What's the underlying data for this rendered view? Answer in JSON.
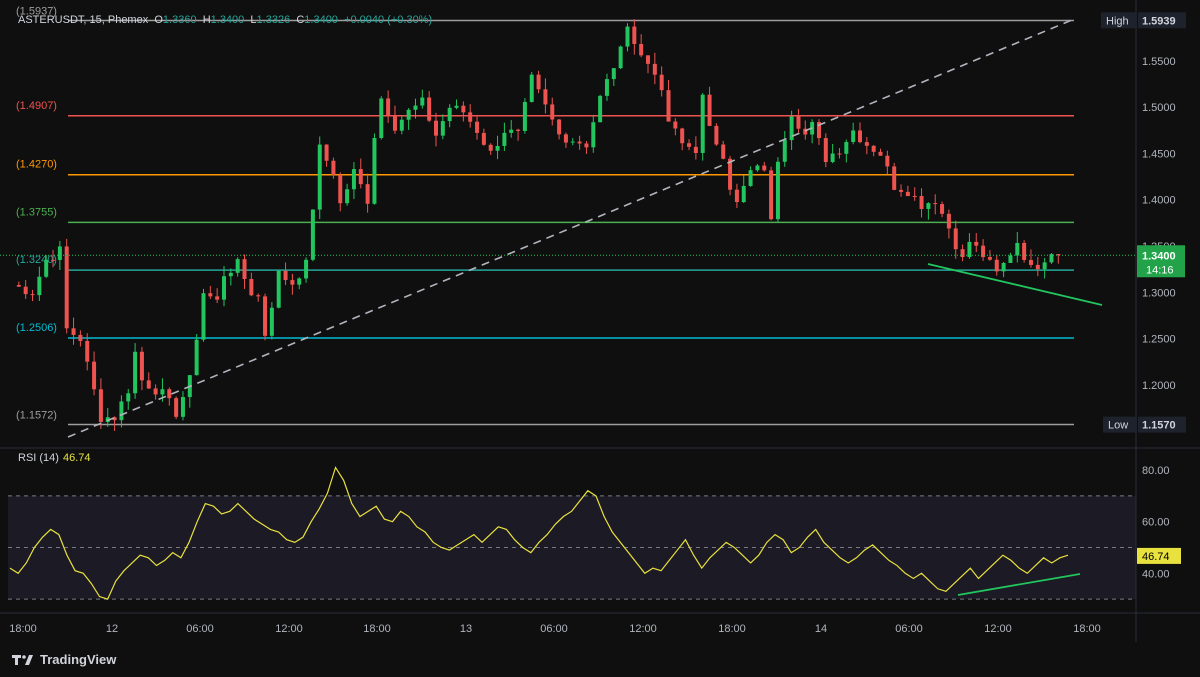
{
  "header": {
    "symbol": "ASTERUSDT, 15, Phemex",
    "open_label": "O",
    "open": "1.3360",
    "high_label": "H",
    "high": "1.3400",
    "low_label": "L",
    "low": "1.3326",
    "close_label": "C",
    "close": "1.3400",
    "change": "+0.0040 (+0.30%)"
  },
  "brand": "TradingView",
  "rsi_header": {
    "label": "RSI (14)",
    "value": "46.74"
  },
  "colors": {
    "up": "#26a69a",
    "up_bright": "#22c55e",
    "down": "#ef5350",
    "rsi": "#e8e13e"
  },
  "chart_data": [
    {
      "type": "candlestick",
      "ylim": [
        1.135,
        1.605
      ],
      "y_ticks": [
        "1.5500",
        "1.5000",
        "1.4500",
        "1.4000",
        "1.3500",
        "1.3000",
        "1.2500",
        "1.2000"
      ],
      "x_ticks": [
        "18:00",
        "12",
        "06:00",
        "12:00",
        "18:00",
        "13",
        "06:00",
        "12:00",
        "18:00",
        "14",
        "06:00",
        "12:00",
        "18:00"
      ],
      "levels": [
        {
          "label": "(1.5937)",
          "value": 1.5937,
          "color": "#9e9e9e"
        },
        {
          "label": "(1.4907)",
          "value": 1.4907,
          "color": "#ef5350"
        },
        {
          "label": "(1.4270)",
          "value": 1.427,
          "color": "#ff9800"
        },
        {
          "label": "(1.3755)",
          "value": 1.3755,
          "color": "#4caf50"
        },
        {
          "label": "(1.3240)",
          "value": 1.324,
          "color": "#26a69a"
        },
        {
          "label": "(1.2506)",
          "value": 1.2506,
          "color": "#00bcd4"
        },
        {
          "label": "(1.1572)",
          "value": 1.1572,
          "color": "#9e9e9e"
        }
      ],
      "high_badge": {
        "label": "High",
        "value": "1.5939"
      },
      "low_badge": {
        "label": "Low",
        "value": "1.1570"
      },
      "last_price": {
        "value": "1.3400",
        "countdown": "14:16"
      },
      "path": [
        [
          0,
          1.308
        ],
        [
          3,
          1.3
        ],
        [
          5,
          1.335
        ],
        [
          7,
          1.345
        ],
        [
          8,
          1.26
        ],
        [
          10,
          1.25
        ],
        [
          13,
          1.165
        ],
        [
          15,
          1.165
        ],
        [
          17,
          1.195
        ],
        [
          18,
          1.235
        ],
        [
          19,
          1.205
        ],
        [
          22,
          1.19
        ],
        [
          24,
          1.17
        ],
        [
          26,
          1.205
        ],
        [
          28,
          1.3
        ],
        [
          30,
          1.29
        ],
        [
          31,
          1.32
        ],
        [
          33,
          1.33
        ],
        [
          35,
          1.3
        ],
        [
          36,
          1.295
        ],
        [
          37,
          1.255
        ],
        [
          39,
          1.32
        ],
        [
          41,
          1.31
        ],
        [
          43,
          1.33
        ],
        [
          45,
          1.455
        ],
        [
          47,
          1.43
        ],
        [
          48,
          1.395
        ],
        [
          50,
          1.43
        ],
        [
          52,
          1.4
        ],
        [
          53,
          1.47
        ],
        [
          54,
          1.51
        ],
        [
          56,
          1.48
        ],
        [
          58,
          1.495
        ],
        [
          60,
          1.505
        ],
        [
          62,
          1.47
        ],
        [
          64,
          1.5
        ],
        [
          66,
          1.495
        ],
        [
          68,
          1.475
        ],
        [
          70,
          1.45
        ],
        [
          72,
          1.475
        ],
        [
          74,
          1.47
        ],
        [
          76,
          1.53
        ],
        [
          78,
          1.5
        ],
        [
          80,
          1.47
        ],
        [
          82,
          1.465
        ],
        [
          84,
          1.46
        ],
        [
          86,
          1.51
        ],
        [
          88,
          1.545
        ],
        [
          89,
          1.56
        ],
        [
          90,
          1.593
        ],
        [
          91,
          1.57
        ],
        [
          92,
          1.555
        ],
        [
          94,
          1.54
        ],
        [
          96,
          1.485
        ],
        [
          98,
          1.46
        ],
        [
          100,
          1.455
        ],
        [
          101,
          1.51
        ],
        [
          102,
          1.475
        ],
        [
          104,
          1.45
        ],
        [
          105,
          1.415
        ],
        [
          106,
          1.395
        ],
        [
          108,
          1.43
        ],
        [
          110,
          1.435
        ],
        [
          111,
          1.375
        ],
        [
          112,
          1.445
        ],
        [
          114,
          1.495
        ],
        [
          116,
          1.47
        ],
        [
          117,
          1.48
        ],
        [
          119,
          1.445
        ],
        [
          121,
          1.455
        ],
        [
          123,
          1.475
        ],
        [
          125,
          1.46
        ],
        [
          127,
          1.45
        ],
        [
          129,
          1.415
        ],
        [
          131,
          1.41
        ],
        [
          133,
          1.395
        ],
        [
          135,
          1.4
        ],
        [
          137,
          1.37
        ],
        [
          139,
          1.335
        ],
        [
          140,
          1.355
        ],
        [
          142,
          1.34
        ],
        [
          144,
          1.32
        ],
        [
          145,
          1.33
        ],
        [
          147,
          1.355
        ],
        [
          149,
          1.325
        ],
        [
          150,
          1.33
        ],
        [
          152,
          1.345
        ],
        [
          153,
          1.34
        ]
      ]
    },
    {
      "type": "line",
      "title": "RSI (14)",
      "ylim": [
        25,
        87
      ],
      "y_ticks": [
        "80.00",
        "60.00",
        "40.00"
      ],
      "bands": [
        70,
        50,
        30
      ],
      "last_value": "46.74",
      "values": [
        42,
        40,
        44,
        50,
        54,
        57,
        55,
        47,
        41,
        40,
        36,
        31,
        30,
        37,
        41,
        44,
        47,
        46,
        43,
        45,
        48,
        46,
        52,
        60,
        67,
        66,
        63,
        64,
        67,
        64,
        61,
        59,
        57,
        56,
        53,
        52,
        54,
        60,
        65,
        71,
        81,
        76,
        67,
        62,
        64,
        66,
        61,
        60,
        64,
        62,
        58,
        56,
        52,
        50,
        49,
        51,
        53,
        55,
        52,
        55,
        58,
        57,
        53,
        50,
        48,
        52,
        55,
        59,
        62,
        64,
        68,
        72,
        70,
        62,
        56,
        52,
        48,
        44,
        40,
        42,
        41,
        45,
        49,
        53,
        47,
        42,
        46,
        49,
        52,
        50,
        47,
        44,
        47,
        52,
        55,
        53,
        48,
        50,
        54,
        57,
        52,
        49,
        46,
        44,
        46,
        49,
        51,
        48,
        45,
        43,
        40,
        38,
        40,
        37,
        34,
        33,
        36,
        39,
        42,
        38,
        41,
        44,
        47,
        45,
        42,
        40,
        43,
        46,
        44,
        46,
        47
      ]
    }
  ]
}
